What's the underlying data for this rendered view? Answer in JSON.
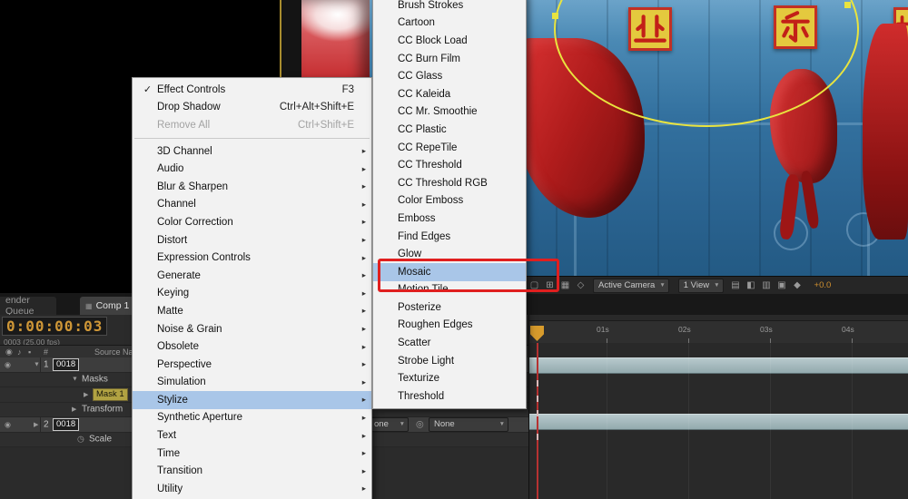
{
  "icons": {
    "checkmark": "✓",
    "submenu_arrow": "▸",
    "dropdown_arrow": "▼",
    "twirl_open": "▼",
    "twirl_closed": "▶",
    "close": "×",
    "pickwhip": "◎",
    "eye": "◉",
    "audio": "♪",
    "lock": "▪",
    "stopwatch": "◷",
    "comp": "▦"
  },
  "effect_menu": {
    "items": [
      {
        "label": "Effect Controls",
        "shortcut": "F3",
        "checked": true
      },
      {
        "label": "Drop Shadow",
        "shortcut": "Ctrl+Alt+Shift+E"
      },
      {
        "label": "Remove All",
        "shortcut": "Ctrl+Shift+E",
        "disabled": true
      },
      {
        "separator": true
      },
      {
        "label": "3D Channel",
        "submenu": true
      },
      {
        "label": "Audio",
        "submenu": true
      },
      {
        "label": "Blur & Sharpen",
        "submenu": true
      },
      {
        "label": "Channel",
        "submenu": true
      },
      {
        "label": "Color Correction",
        "submenu": true
      },
      {
        "label": "Distort",
        "submenu": true
      },
      {
        "label": "Expression Controls",
        "submenu": true
      },
      {
        "label": "Generate",
        "submenu": true
      },
      {
        "label": "Keying",
        "submenu": true
      },
      {
        "label": "Matte",
        "submenu": true
      },
      {
        "label": "Noise & Grain",
        "submenu": true
      },
      {
        "label": "Obsolete",
        "submenu": true
      },
      {
        "label": "Perspective",
        "submenu": true
      },
      {
        "label": "Simulation",
        "submenu": true
      },
      {
        "label": "Stylize",
        "submenu": true,
        "highlighted": true
      },
      {
        "label": "Synthetic Aperture",
        "submenu": true
      },
      {
        "label": "Text",
        "submenu": true
      },
      {
        "label": "Time",
        "submenu": true
      },
      {
        "label": "Transition",
        "submenu": true
      },
      {
        "label": "Utility",
        "submenu": true
      }
    ]
  },
  "stylize_submenu": {
    "highlighted": "Mosaic",
    "items": [
      "Brush Strokes",
      "Cartoon",
      "CC Block Load",
      "CC Burn Film",
      "CC Glass",
      "CC Kaleida",
      "CC Mr. Smoothie",
      "CC Plastic",
      "CC RepeTile",
      "CC Threshold",
      "CC Threshold RGB",
      "Color Emboss",
      "Emboss",
      "Find Edges",
      "Glow",
      "Mosaic",
      "Motion Tile",
      "Posterize",
      "Roughen Edges",
      "Scatter",
      "Strobe Light",
      "Texturize",
      "Threshold"
    ]
  },
  "viewer": {
    "plaque_characters": [
      "业",
      "乐"
    ],
    "toolbar": {
      "left_icons": [
        {
          "name": "region-of-interest-icon",
          "glyph": "▢"
        },
        {
          "name": "grid-and-guides-icon",
          "glyph": "⊞"
        },
        {
          "name": "transparency-grid-icon",
          "glyph": "▦"
        },
        {
          "name": "mask-visibility-icon",
          "glyph": "◇"
        }
      ],
      "camera_select": "Active Camera",
      "view_select": "1 View",
      "right_icons": [
        {
          "name": "view-options-icon",
          "glyph": "▤"
        },
        {
          "name": "channels-icon",
          "glyph": "◧"
        },
        {
          "name": "resolution-icon",
          "glyph": "▥"
        },
        {
          "name": "pixel-aspect-icon",
          "glyph": "▣"
        },
        {
          "name": "fast-previews-icon",
          "glyph": "◆"
        }
      ],
      "exposure": "+0.0"
    }
  },
  "timeline": {
    "tabs": [
      {
        "label": "ender Queue"
      },
      {
        "label": "Comp 1"
      }
    ],
    "timecode": "0:00:00:03",
    "frame_info": "0003 (25.00 fps)",
    "columns": {
      "index": "#",
      "source_name": "Source Nam"
    },
    "ruler_ticks": [
      "01s",
      "02s",
      "03s",
      "04s"
    ],
    "rows": [
      {
        "index": "1",
        "name": "0018"
      },
      {
        "label": "Masks"
      },
      {
        "label": "Mask 1"
      },
      {
        "label": "Transform"
      },
      {
        "index": "2",
        "name": "0018"
      },
      {
        "label": "Scale"
      }
    ],
    "parent_dropdowns": [
      {
        "value": "one"
      },
      {
        "value": "None"
      }
    ]
  },
  "colors": {
    "annotation": "#e01f1f",
    "menu_highlight": "#a9c6e8",
    "timecode": "#cf9737",
    "mask_outline": "#e9e43f"
  }
}
